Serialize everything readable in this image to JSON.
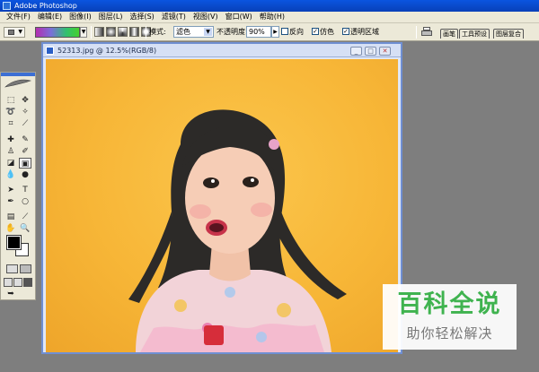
{
  "app": {
    "title": "Adobe Photoshop"
  },
  "menu": [
    "文件(F)",
    "编辑(E)",
    "图像(I)",
    "图层(L)",
    "选择(S)",
    "滤镜(T)",
    "视图(V)",
    "窗口(W)",
    "帮助(H)"
  ],
  "options": {
    "mode_label": "模式:",
    "mode_value": "滤色",
    "opacity_label": "不透明度:",
    "opacity_value": "90%",
    "reverse_label": "反向",
    "dither_label": "仿色",
    "transparency_label": "透明区域",
    "reverse_checked": false,
    "dither_checked": true,
    "transparency_checked": true
  },
  "palette_well": {
    "tabs": [
      "画笔",
      "工具预设",
      "图层复合"
    ]
  },
  "document": {
    "title": "52313.jpg @ 12.5%(RGB/8)"
  },
  "colors": {
    "canvas_bg": "#f7b637",
    "foreground": "#000000",
    "background": "#ffffff",
    "watermark_green": "#3fb34f"
  },
  "watermark": {
    "title": "百科全说",
    "subtitle": "助你轻松解决"
  }
}
